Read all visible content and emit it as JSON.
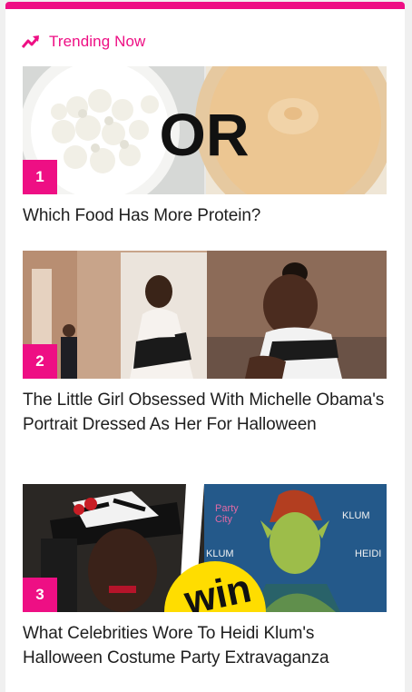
{
  "widget": {
    "title": "Trending Now",
    "accent_color": "#ee0f84",
    "icon": "trending-up-icon"
  },
  "items": [
    {
      "rank": "1",
      "title": "Which Food Has More Protein?",
      "thumb_overlay_text": "OR"
    },
    {
      "rank": "2",
      "title": "The Little Girl Obsessed With Michelle Obama's Portrait Dressed As Her For Halloween"
    },
    {
      "rank": "3",
      "title": "What Celebrities Wore To Heidi Klum's Halloween Costume Party Extravaganza",
      "thumb_overlay_text": "win"
    }
  ]
}
